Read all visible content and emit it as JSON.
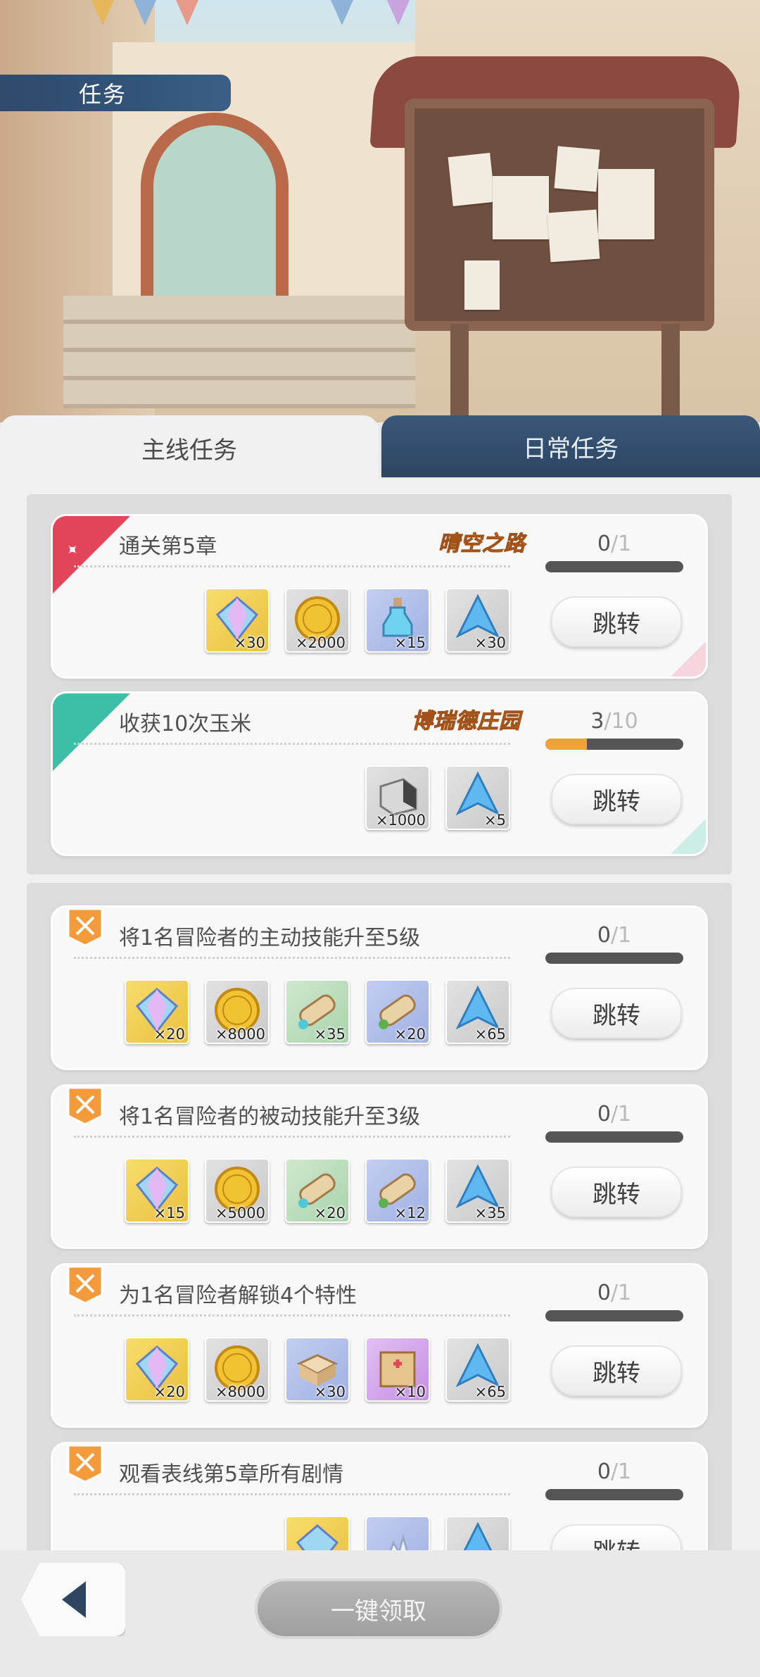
{
  "header": {
    "title": "任务"
  },
  "tabs": [
    {
      "label": "主线任务",
      "active": true
    },
    {
      "label": "日常任务",
      "active": false
    }
  ],
  "jump_label": "跳转",
  "featured_quests": [
    {
      "title": "通关第5章",
      "tag": "晴空之路",
      "progress": "0",
      "total": "/1",
      "progress_fraction": 0,
      "rewards": [
        {
          "icon": "gem-icon",
          "count": "×30"
        },
        {
          "icon": "gold-coin-icon",
          "count": "×2000"
        },
        {
          "icon": "potion-bottle-icon",
          "count": "×15"
        },
        {
          "icon": "exp-crystal-icon",
          "label": "经验值",
          "count": "×30"
        }
      ]
    },
    {
      "title": "收获10次玉米",
      "tag": "博瑞德庄园",
      "progress": "3",
      "total": "/10",
      "progress_fraction": 0.3,
      "rewards": [
        {
          "icon": "ore-block-icon",
          "count": "×1000"
        },
        {
          "icon": "exp-crystal-icon",
          "label": "经验值",
          "count": "×5"
        }
      ]
    }
  ],
  "quests": [
    {
      "title": "将1名冒险者的主动技能升至5级",
      "progress": "0",
      "total": "/1",
      "rewards": [
        {
          "icon": "gem-icon",
          "count": "×20"
        },
        {
          "icon": "gold-coin-icon",
          "count": "×8000"
        },
        {
          "icon": "skill-scroll-blue-icon",
          "count": "×35"
        },
        {
          "icon": "skill-scroll-green-icon",
          "count": "×20"
        },
        {
          "icon": "exp-crystal-icon",
          "label": "经验值",
          "count": "×65"
        }
      ]
    },
    {
      "title": "将1名冒险者的被动技能升至3级",
      "progress": "0",
      "total": "/1",
      "rewards": [
        {
          "icon": "gem-icon",
          "count": "×15"
        },
        {
          "icon": "gold-coin-icon",
          "count": "×5000"
        },
        {
          "icon": "skill-scroll-blue-icon",
          "count": "×20"
        },
        {
          "icon": "skill-scroll-green-icon",
          "count": "×12"
        },
        {
          "icon": "exp-crystal-icon",
          "label": "经验值",
          "count": "×35"
        }
      ]
    },
    {
      "title": "为1名冒险者解锁4个特性",
      "progress": "0",
      "total": "/1",
      "rewards": [
        {
          "icon": "gem-icon",
          "count": "×20"
        },
        {
          "icon": "gold-coin-icon",
          "count": "×8000"
        },
        {
          "icon": "parcel-icon",
          "count": "×30"
        },
        {
          "icon": "supply-crate-icon",
          "count": "×10"
        },
        {
          "icon": "exp-crystal-icon",
          "label": "经验值",
          "count": "×65"
        }
      ]
    },
    {
      "title": "观看表线第5章所有剧情",
      "progress": "0",
      "total": "/1",
      "rewards": [
        {
          "icon": "gem-icon",
          "count": ""
        },
        {
          "icon": "frost-crystal-icon",
          "count": ""
        },
        {
          "icon": "exp-crystal-icon",
          "count": ""
        }
      ]
    }
  ],
  "bottom": {
    "claim_all": "一键领取"
  },
  "colors": {
    "navy": "#2f4a6b",
    "progress_fill": "#f3a13a",
    "ribbon_red": "#e2445a",
    "ribbon_teal": "#3dbfa7",
    "badge_orange": "#f39a3a"
  }
}
